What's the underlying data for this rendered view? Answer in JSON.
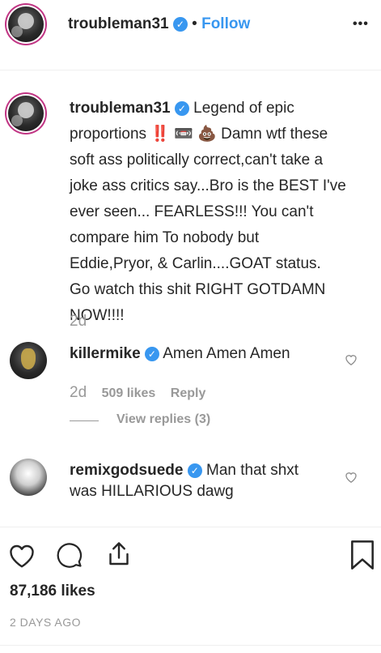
{
  "header": {
    "username": "troubleman31",
    "separator": "•",
    "follow_label": "Follow",
    "more_icon": "•••"
  },
  "caption": {
    "username": "troubleman31",
    "text_line1": "Legend of epic",
    "text_rest": [
      "proportions ‼️ 📼 💩 Damn wtf these",
      "soft ass politically correct,can't take a",
      "joke ass critics say...Bro is the BEST I've",
      "ever seen... FEARLESS!!! You can't",
      "compare him To nobody but",
      "Eddie,Pryor, & Carlin....GOAT status.",
      "Go watch this shit RIGHT GOTDAMN",
      "NOW!!!!"
    ],
    "time": "2d"
  },
  "comments": [
    {
      "username": "killermike",
      "text": "Amen Amen Amen",
      "time": "2d",
      "likes": "509 likes",
      "reply_label": "Reply",
      "view_replies": "View replies (3)"
    },
    {
      "username": "remixgodsuede",
      "text_line1": "Man that shxt",
      "text_line2": "was HILLARIOUS dawg"
    }
  ],
  "actions": {
    "likes": "87,186 likes",
    "posted": "2 DAYS AGO"
  },
  "colors": {
    "follow": "#3897f0",
    "verified": "#3897f0",
    "muted": "#999999",
    "story_ring": "#c13584"
  }
}
